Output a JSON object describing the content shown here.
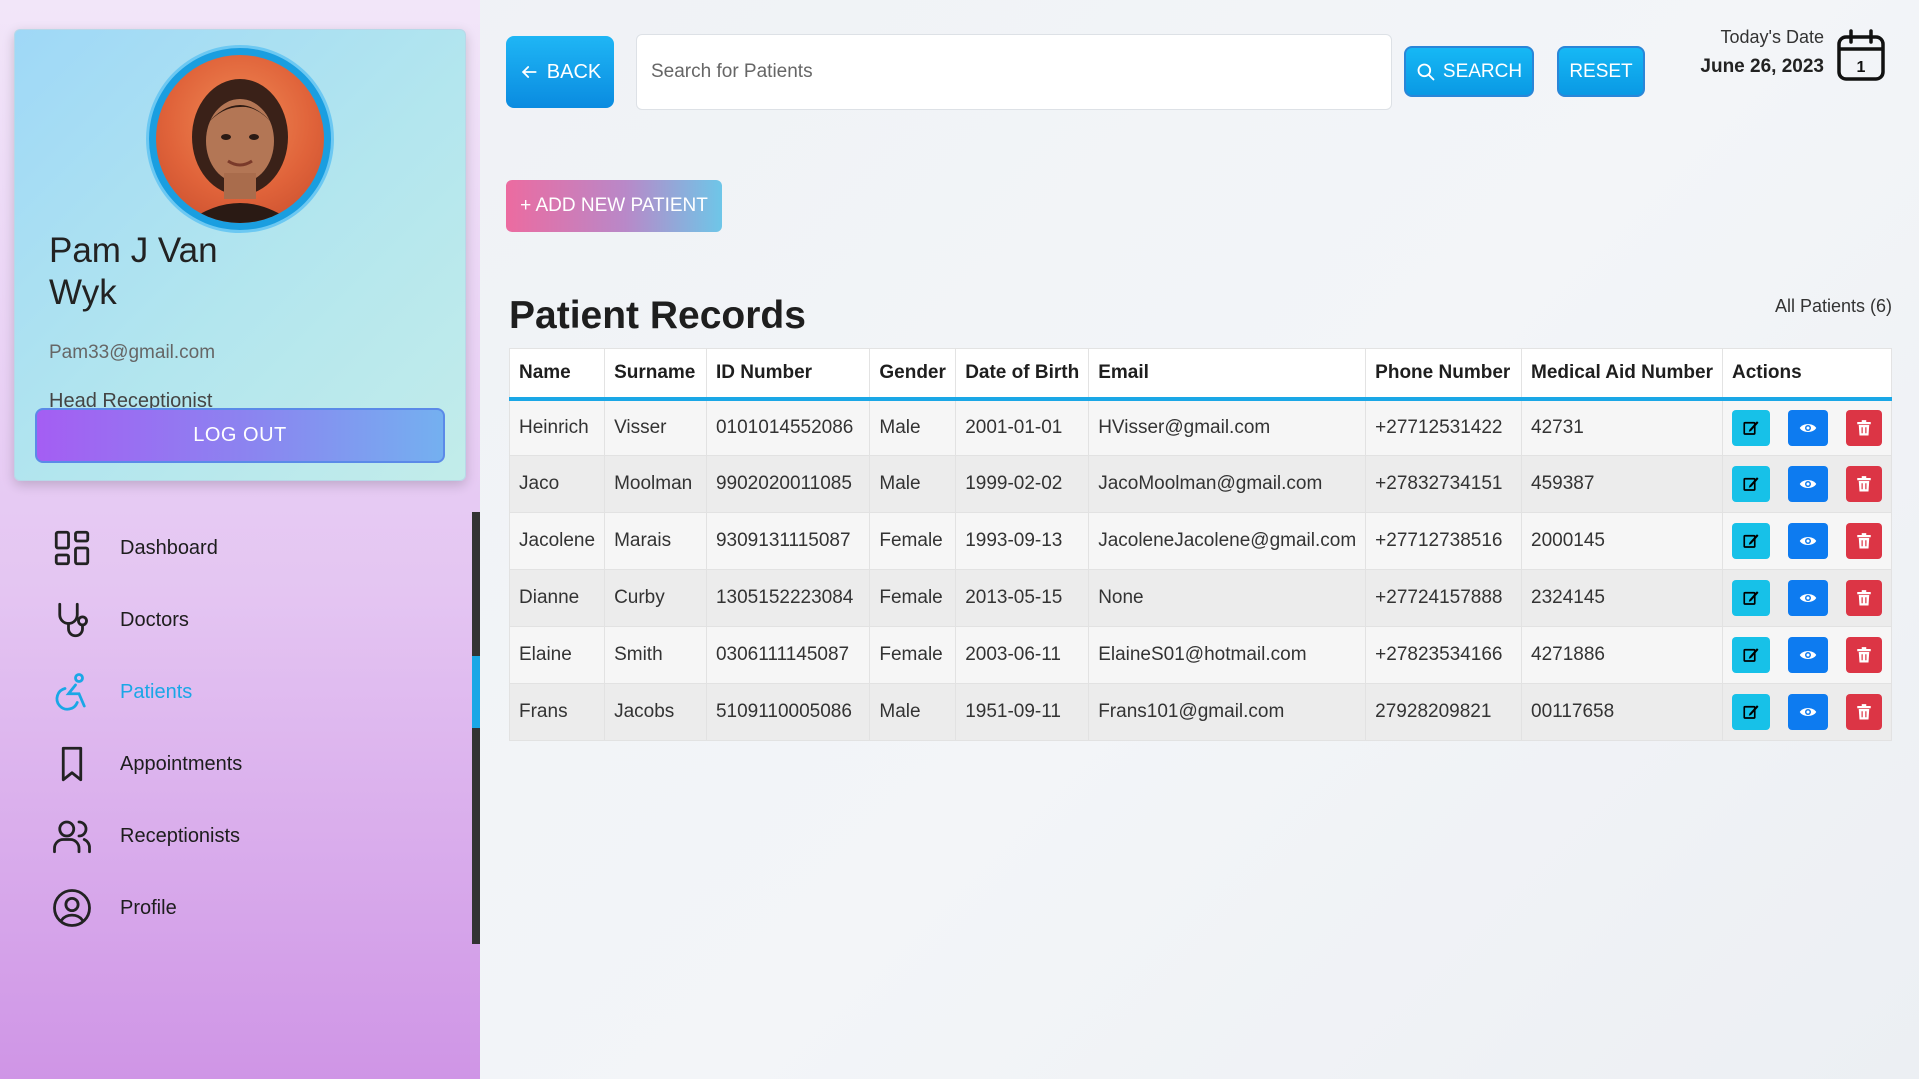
{
  "sidebar": {
    "profile": {
      "name": "Pam J Van Wyk",
      "email": "Pam33@gmail.com",
      "role": "Head Receptionist",
      "logout_label": "LOG OUT"
    },
    "nav": [
      {
        "label": "Dashboard",
        "icon": "dashboard-icon"
      },
      {
        "label": "Doctors",
        "icon": "stethoscope-icon"
      },
      {
        "label": "Patients",
        "icon": "wheelchair-icon",
        "active": true
      },
      {
        "label": "Appointments",
        "icon": "bookmark-icon"
      },
      {
        "label": "Receptionists",
        "icon": "users-icon"
      },
      {
        "label": "Profile",
        "icon": "user-circle-icon"
      }
    ]
  },
  "toolbar": {
    "back_label": "BACK",
    "search_placeholder": "Search for Patients",
    "search_value": "",
    "search_label": "SEARCH",
    "reset_label": "RESET",
    "date_label": "Today's Date",
    "date_value": "June 26, 2023",
    "calendar_day": "1"
  },
  "add_label": "+ ADD NEW PATIENT",
  "records": {
    "title": "Patient Records",
    "count_label": "All Patients (6)",
    "columns": [
      "Name",
      "Surname",
      "ID Number",
      "Gender",
      "Date of Birth",
      "Email",
      "Phone Number",
      "Medical Aid Number",
      "Actions"
    ],
    "rows": [
      [
        "Heinrich",
        "Visser",
        "0101014552086",
        "Male",
        "2001-01-01",
        "HVisser@gmail.com",
        "+27712531422",
        "42731"
      ],
      [
        "Jaco",
        "Moolman",
        "9902020011085",
        "Male",
        "1999-02-02",
        "JacoMoolman@gmail.com",
        "+27832734151",
        "459387"
      ],
      [
        "Jacolene",
        "Marais",
        "9309131115087",
        "Female",
        "1993-09-13",
        "JacoleneJacolene@gmail.com",
        "+27712738516",
        "2000145"
      ],
      [
        "Dianne",
        "Curby",
        "1305152223084",
        "Female",
        "2013-05-15",
        "None",
        "+27724157888",
        "2324145"
      ],
      [
        "Elaine",
        "Smith",
        "0306111145087",
        "Female",
        "2003-06-11",
        "ElaineS01@hotmail.com",
        "+27823534166",
        "4271886"
      ],
      [
        "Frans",
        "Jacobs",
        "5109110005086",
        "Male",
        "1951-09-11",
        "Frans101@gmail.com",
        "27928209821",
        "00117658"
      ]
    ]
  },
  "colors": {
    "accent": "#1aa7e6",
    "edit": "#17c1e8",
    "view": "#0d7bf0",
    "delete": "#dc3545"
  }
}
